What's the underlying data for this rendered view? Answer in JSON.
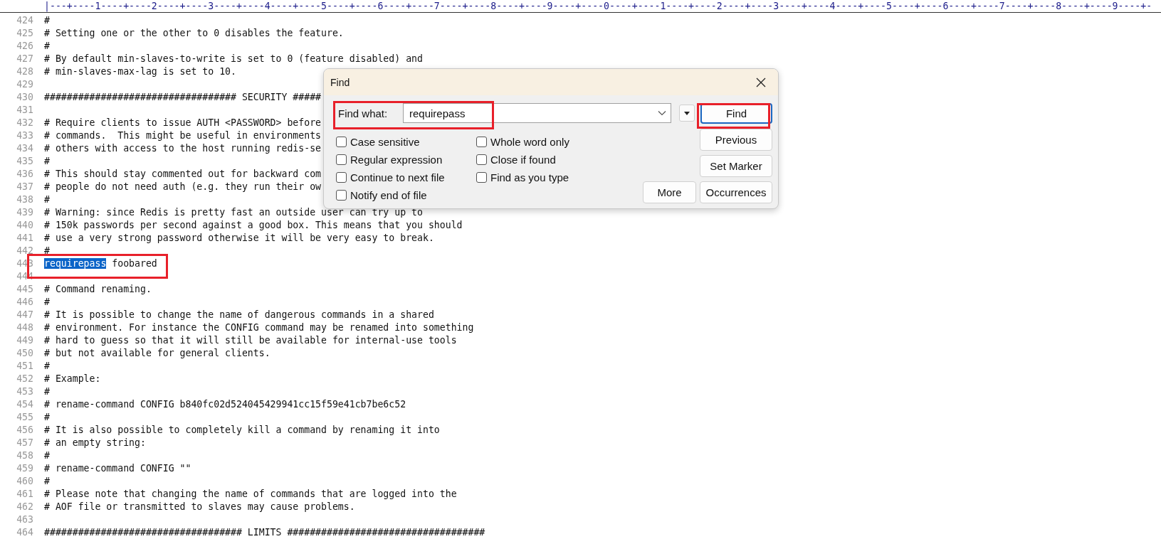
{
  "ruler": "|---+----1----+----2----+----3----+----4----+----5----+----6----+----7----+----8----+----9----+----0----+----1----+----2----+----3----+----4----+----5----+----6----+----7----+----8----+----9----+-",
  "lines": [
    {
      "number": "424",
      "text": "#"
    },
    {
      "number": "425",
      "text": "# Setting one or the other to 0 disables the feature."
    },
    {
      "number": "426",
      "text": "#"
    },
    {
      "number": "427",
      "text": "# By default min-slaves-to-write is set to 0 (feature disabled) and"
    },
    {
      "number": "428",
      "text": "# min-slaves-max-lag is set to 10."
    },
    {
      "number": "429"
    },
    {
      "number": "430",
      "text": "################################## SECURITY #####"
    },
    {
      "number": "431"
    },
    {
      "number": "432",
      "text": "# Require clients to issue AUTH <PASSWORD> before"
    },
    {
      "number": "433",
      "text": "# commands.  This might be useful in environments"
    },
    {
      "number": "434",
      "text": "# others with access to the host running redis-se"
    },
    {
      "number": "435",
      "text": "#"
    },
    {
      "number": "436",
      "text": "# This should stay commented out for backward com"
    },
    {
      "number": "437",
      "text": "# people do not need auth (e.g. they run their ow"
    },
    {
      "number": "438",
      "text": "#"
    },
    {
      "number": "439",
      "text": "# Warning: since Redis is pretty fast an outside user can try up to"
    },
    {
      "number": "440",
      "text": "# 150k passwords per second against a good box. This means that you should"
    },
    {
      "number": "441",
      "text": "# use a very strong password otherwise it will be very easy to break."
    },
    {
      "number": "442",
      "text": "#"
    },
    {
      "number": "443",
      "selected_text": "requirepass",
      "text": " foobared",
      "marked": true
    },
    {
      "number": "444"
    },
    {
      "number": "445",
      "text": "# Command renaming."
    },
    {
      "number": "446",
      "text": "#"
    },
    {
      "number": "447",
      "text": "# It is possible to change the name of dangerous commands in a shared"
    },
    {
      "number": "448",
      "text": "# environment. For instance the CONFIG command may be renamed into something"
    },
    {
      "number": "449",
      "text": "# hard to guess so that it will still be available for internal-use tools"
    },
    {
      "number": "450",
      "text": "# but not available for general clients."
    },
    {
      "number": "451",
      "text": "#"
    },
    {
      "number": "452",
      "text": "# Example:"
    },
    {
      "number": "453",
      "text": "#"
    },
    {
      "number": "454",
      "text": "# rename-command CONFIG b840fc02d524045429941cc15f59e41cb7be6c52"
    },
    {
      "number": "455",
      "text": "#"
    },
    {
      "number": "456",
      "text": "# It is also possible to completely kill a command by renaming it into"
    },
    {
      "number": "457",
      "text": "# an empty string:"
    },
    {
      "number": "458",
      "text": "#"
    },
    {
      "number": "459",
      "text": "# rename-command CONFIG \"\""
    },
    {
      "number": "460",
      "text": "#"
    },
    {
      "number": "461",
      "text": "# Please note that changing the name of commands that are logged into the"
    },
    {
      "number": "462",
      "text": "# AOF file or transmitted to slaves may cause problems."
    },
    {
      "number": "463"
    },
    {
      "number": "464",
      "text": "################################### LIMITS ###################################"
    }
  ],
  "find_dialog": {
    "title": "Find",
    "find_what": {
      "label": "Find what:",
      "value": "requirepass",
      "marked": true
    },
    "checkboxes": [
      {
        "label": "Case sensitive",
        "checked": false
      },
      {
        "label": "Whole word only",
        "checked": false
      },
      {
        "label": "Regular expression",
        "checked": false
      },
      {
        "label": "Close if found",
        "checked": false
      },
      {
        "label": "Continue to next file",
        "checked": false
      },
      {
        "label": "Find as you type",
        "checked": false
      },
      {
        "label": "Notify end of file",
        "checked": false
      }
    ],
    "buttons": [
      {
        "kind": "find",
        "label": "Find",
        "focused": true,
        "marked": true
      },
      {
        "kind": "side",
        "label": "Previous",
        "focused": false
      },
      {
        "kind": "side",
        "label": "Set Marker",
        "focused": false
      },
      {
        "kind": "more",
        "label": "More",
        "focused": false
      },
      {
        "kind": "side",
        "label": "Occurrences",
        "focused": false
      }
    ]
  }
}
